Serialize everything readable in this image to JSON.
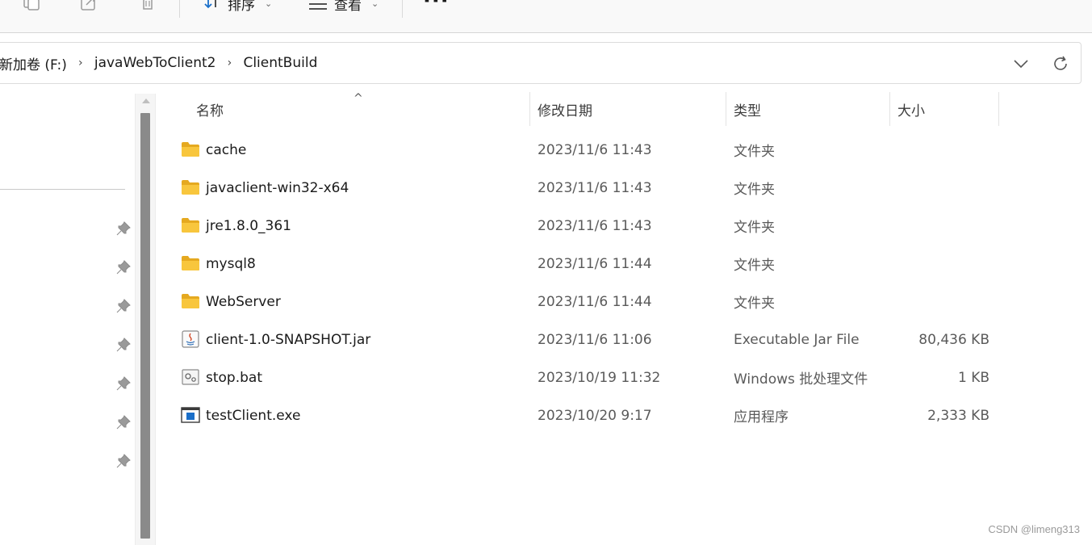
{
  "toolbar": {
    "sort_label": "排序",
    "view_label": "查看",
    "more_label": "···"
  },
  "address": {
    "crumbs": [
      "新加卷 (F:)",
      "javaWebToClient2",
      "ClientBuild"
    ],
    "separator": "›"
  },
  "columns": {
    "name": "名称",
    "date": "修改日期",
    "type": "类型",
    "size": "大小",
    "sort_indicator": "^"
  },
  "files": [
    {
      "name": "cache",
      "date": "2023/11/6 11:43",
      "type": "文件夹",
      "size": "",
      "icon": "folder-icon"
    },
    {
      "name": "javaclient-win32-x64",
      "date": "2023/11/6 11:43",
      "type": "文件夹",
      "size": "",
      "icon": "folder-icon"
    },
    {
      "name": "jre1.8.0_361",
      "date": "2023/11/6 11:43",
      "type": "文件夹",
      "size": "",
      "icon": "folder-icon"
    },
    {
      "name": "mysql8",
      "date": "2023/11/6 11:44",
      "type": "文件夹",
      "size": "",
      "icon": "folder-icon"
    },
    {
      "name": "WebServer",
      "date": "2023/11/6 11:44",
      "type": "文件夹",
      "size": "",
      "icon": "folder-icon"
    },
    {
      "name": "client-1.0-SNAPSHOT.jar",
      "date": "2023/11/6 11:06",
      "type": "Executable Jar File",
      "size": "80,436 KB",
      "icon": "jar-file-icon"
    },
    {
      "name": "stop.bat",
      "date": "2023/10/19 11:32",
      "type": "Windows 批处理文件",
      "size": "1 KB",
      "icon": "batch-file-icon"
    },
    {
      "name": "testClient.exe",
      "date": "2023/10/20 9:17",
      "type": "应用程序",
      "size": "2,333 KB",
      "icon": "exe-file-icon"
    }
  ],
  "watermark": "CSDN @limeng313",
  "colors": {
    "folder": "#f8c63d",
    "folder_dark": "#e5a920",
    "scroll_thumb": "#8a8a8a",
    "exe_blue": "#1a6fc9"
  }
}
